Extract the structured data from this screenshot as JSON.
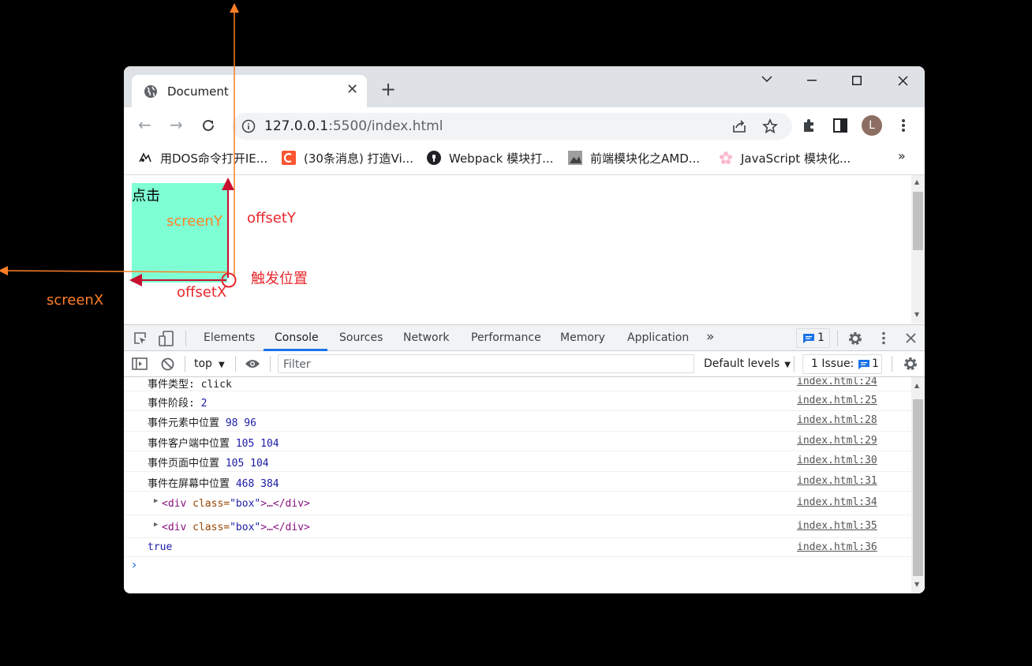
{
  "tab": {
    "title": "Document"
  },
  "address": {
    "host": "127.0.0.1",
    "rest": ":5500/index.html"
  },
  "bookmarks": [
    {
      "label": "用DOS命令打开IE...",
      "icon": "dos-icon"
    },
    {
      "label": "(30条消息) 打造Vi...",
      "icon": "csdn-icon"
    },
    {
      "label": "Webpack 模块打...",
      "icon": "webpack-icon"
    },
    {
      "label": "前端模块化之AMD...",
      "icon": "image-icon"
    },
    {
      "label": "JavaScript 模块化...",
      "icon": "flower-icon"
    }
  ],
  "bookmarks_more": "»",
  "profile": "L",
  "demo": {
    "box_text": "点击",
    "screenY": "screenY",
    "offsetY": "offsetY",
    "trigger": "触发位置",
    "offsetX": "offsetX",
    "screenX": "screenX"
  },
  "devtools": {
    "tabs": [
      "Elements",
      "Console",
      "Sources",
      "Network",
      "Performance",
      "Memory",
      "Application"
    ],
    "more": "»",
    "issues_badge": "1",
    "context": "top",
    "filter_placeholder": "Filter",
    "levels": "Default levels",
    "issue_label": "1 Issue:",
    "issue_count": "1"
  },
  "console": [
    {
      "text": "事件类型: ",
      "value": "click",
      "src": "index.html:24"
    },
    {
      "text": "事件阶段: ",
      "value": "2",
      "src": "index.html:25"
    },
    {
      "text": "事件元素中位置 ",
      "value": "98 96",
      "src": "index.html:28"
    },
    {
      "text": "事件客户端中位置 ",
      "value": "105 104",
      "src": "index.html:29"
    },
    {
      "text": "事件页面中位置 ",
      "value": "105 104",
      "src": "index.html:30"
    },
    {
      "text": "事件在屏幕中位置 ",
      "value": "468 384",
      "src": "index.html:31"
    }
  ],
  "elements_rows": [
    {
      "open": "<div",
      "attr": " class=",
      "val": "\"box\"",
      "close": ">…</div>",
      "src": "index.html:34"
    },
    {
      "open": "<div",
      "attr": " class=",
      "val": "\"box\"",
      "close": ">…</div>",
      "src": "index.html:35"
    }
  ],
  "true_row": {
    "value": "true",
    "src": "index.html:36"
  },
  "prompt": "›"
}
